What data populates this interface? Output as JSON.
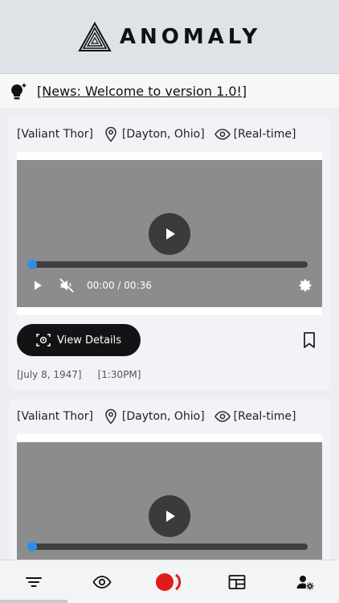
{
  "app": {
    "name": "ANOMALY"
  },
  "news": {
    "text": "[News: Welcome to version 1.0!]"
  },
  "cards": [
    {
      "witness": "[Valiant Thor]",
      "location": "[Dayton, Ohio]",
      "mode": "[Real-time]",
      "video": {
        "time": "00:00 / 00:36",
        "progress": 0
      },
      "details_label": "View Details",
      "date": "[July 8, 1947]",
      "time": "[1:30PM]"
    },
    {
      "witness": "[Valiant Thor]",
      "location": "[Dayton, Ohio]",
      "mode": "[Real-time]",
      "video": {
        "progress": 0
      }
    }
  ],
  "nav": {
    "items": [
      "filter-icon",
      "eye-icon",
      "record-icon",
      "table-icon",
      "user-settings-icon"
    ]
  },
  "colors": {
    "accent_blue": "#2e8de6",
    "record_red": "#e01b1b",
    "dark": "#111315"
  }
}
